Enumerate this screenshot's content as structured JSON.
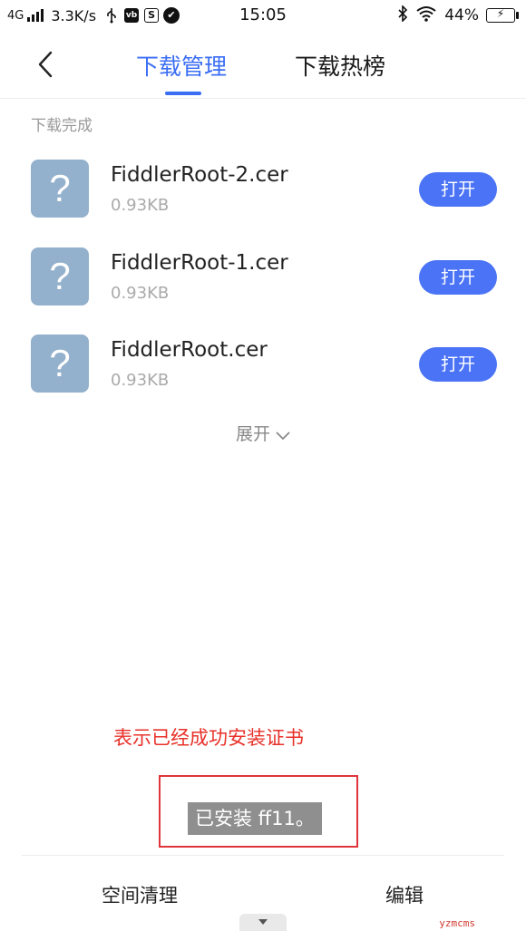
{
  "status_bar": {
    "network": "4G",
    "speed": "3.3K/s",
    "time": "15:05",
    "battery_percent": "44%",
    "icons": [
      "signal-icon",
      "usb-icon",
      "app-notification-icon",
      "s-notification-icon",
      "check-circle-icon",
      "bluetooth-icon",
      "wifi-icon",
      "battery-charging-icon"
    ]
  },
  "header": {
    "tabs": [
      {
        "label": "下载管理",
        "active": true
      },
      {
        "label": "下载热榜",
        "active": false
      }
    ]
  },
  "section": {
    "label": "下载完成"
  },
  "files": [
    {
      "name": "FiddlerRoot-2.cer",
      "size": "0.93KB",
      "icon_glyph": "?",
      "action": "打开"
    },
    {
      "name": "FiddlerRoot-1.cer",
      "size": "0.93KB",
      "icon_glyph": "?",
      "action": "打开"
    },
    {
      "name": "FiddlerRoot.cer",
      "size": "0.93KB",
      "icon_glyph": "?",
      "action": "打开"
    }
  ],
  "expand_label": "展开",
  "annotation": {
    "text": "表示已经成功安装证书",
    "color": "#e8312a"
  },
  "toast": {
    "text": "已安装 ff11。"
  },
  "bottom_bar": {
    "left_action": "空间清理",
    "right_action": "编辑"
  },
  "watermark": "yzmcms",
  "colors": {
    "accent": "#3b6ef5",
    "button": "#4a73f5",
    "file_icon": "#93b0cc"
  }
}
